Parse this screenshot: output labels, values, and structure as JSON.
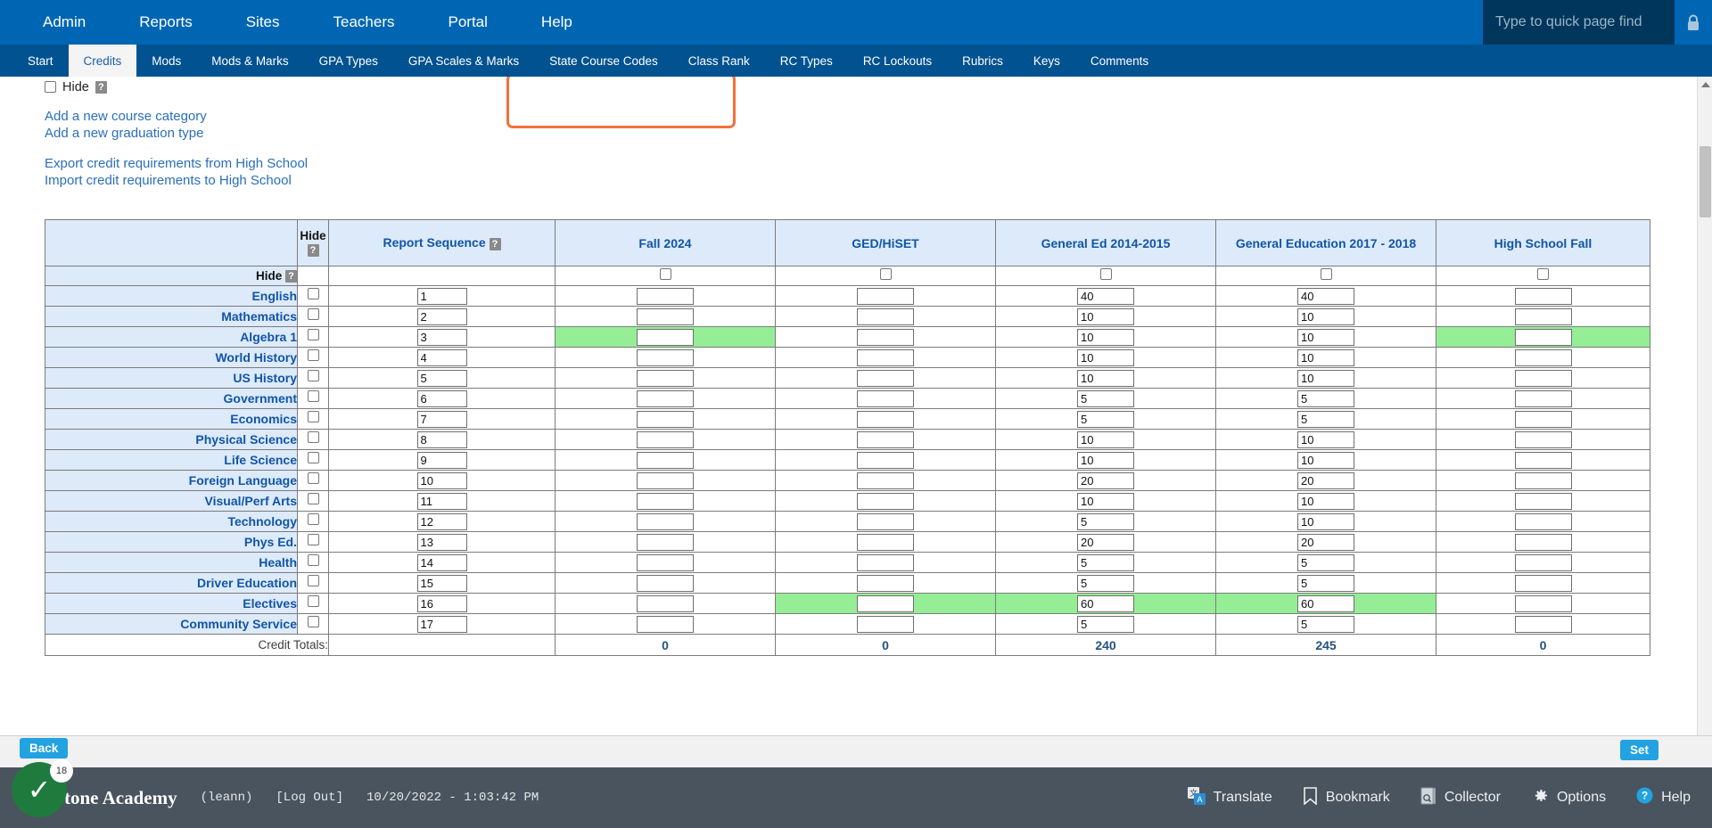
{
  "topnav": {
    "items": [
      "Admin",
      "Reports",
      "Sites",
      "Teachers",
      "Portal",
      "Help"
    ],
    "quick_find_placeholder": "Type to quick page find",
    "lock_icon": "lock-icon"
  },
  "subnav": {
    "items": [
      "Start",
      "Credits",
      "Mods",
      "Mods & Marks",
      "GPA Types",
      "GPA Scales & Marks",
      "State Course Codes",
      "Class Rank",
      "RC Types",
      "RC Lockouts",
      "Rubrics",
      "Keys",
      "Comments"
    ],
    "active": "Credits"
  },
  "content": {
    "hide_label": "Hide",
    "help_glyph": "?",
    "links": [
      "Add a new course category",
      "Add a new graduation type"
    ],
    "links2": [
      "Export credit requirements from High School",
      "Import credit requirements to High School"
    ]
  },
  "table": {
    "hide_col_header": "Hide",
    "hide_row_label": "Hide",
    "totals_label": "Credit Totals:",
    "columns": [
      {
        "label": "Report Sequence",
        "has_help": true,
        "type": "sequence"
      },
      {
        "label": "Fall 2024",
        "has_help": false,
        "type": "credit"
      },
      {
        "label": "GED/HiSET",
        "has_help": false,
        "type": "credit",
        "highlighted": true
      },
      {
        "label": "General Ed 2014-2015",
        "has_help": false,
        "type": "credit"
      },
      {
        "label": "General Education 2017 - 2018",
        "has_help": false,
        "type": "credit"
      },
      {
        "label": "High School Fall",
        "has_help": false,
        "type": "credit"
      }
    ],
    "rows": [
      {
        "label": "English",
        "seq": "1",
        "values": [
          "",
          "",
          "40",
          "40",
          ""
        ],
        "green": []
      },
      {
        "label": "Mathematics",
        "seq": "2",
        "values": [
          "",
          "",
          "10",
          "10",
          ""
        ],
        "green": []
      },
      {
        "label": "Algebra 1",
        "seq": "3",
        "values": [
          "",
          "",
          "10",
          "10",
          ""
        ],
        "green": [
          0,
          4
        ]
      },
      {
        "label": "World History",
        "seq": "4",
        "values": [
          "",
          "",
          "10",
          "10",
          ""
        ],
        "green": []
      },
      {
        "label": "US History",
        "seq": "5",
        "values": [
          "",
          "",
          "10",
          "10",
          ""
        ],
        "green": []
      },
      {
        "label": "Government",
        "seq": "6",
        "values": [
          "",
          "",
          "5",
          "5",
          ""
        ],
        "green": []
      },
      {
        "label": "Economics",
        "seq": "7",
        "values": [
          "",
          "",
          "5",
          "5",
          ""
        ],
        "green": []
      },
      {
        "label": "Physical Science",
        "seq": "8",
        "values": [
          "",
          "",
          "10",
          "10",
          ""
        ],
        "green": []
      },
      {
        "label": "Life Science",
        "seq": "9",
        "values": [
          "",
          "",
          "10",
          "10",
          ""
        ],
        "green": []
      },
      {
        "label": "Foreign Language",
        "seq": "10",
        "values": [
          "",
          "",
          "20",
          "20",
          ""
        ],
        "green": []
      },
      {
        "label": "Visual/Perf Arts",
        "seq": "11",
        "values": [
          "",
          "",
          "10",
          "10",
          ""
        ],
        "green": []
      },
      {
        "label": "Technology",
        "seq": "12",
        "values": [
          "",
          "",
          "5",
          "10",
          ""
        ],
        "green": []
      },
      {
        "label": "Phys Ed.",
        "seq": "13",
        "values": [
          "",
          "",
          "20",
          "20",
          ""
        ],
        "green": []
      },
      {
        "label": "Health",
        "seq": "14",
        "values": [
          "",
          "",
          "5",
          "5",
          ""
        ],
        "green": []
      },
      {
        "label": "Driver Education",
        "seq": "15",
        "values": [
          "",
          "",
          "5",
          "5",
          ""
        ],
        "green": []
      },
      {
        "label": "Electives",
        "seq": "16",
        "values": [
          "",
          "",
          "60",
          "60",
          ""
        ],
        "green": [
          1,
          2,
          3
        ]
      },
      {
        "label": "Community Service",
        "seq": "17",
        "values": [
          "",
          "",
          "5",
          "5",
          ""
        ],
        "green": []
      }
    ],
    "totals": [
      "0",
      "0",
      "240",
      "245",
      "0"
    ]
  },
  "actions": {
    "back_label": "Back",
    "set_label": "Set"
  },
  "toast": {
    "badge_count": "18",
    "check_glyph": "✓"
  },
  "footer": {
    "school": "tone Academy",
    "user": "(leann)",
    "logout": "[Log Out]",
    "datetime": "10/20/2022 - 1:03:42 PM",
    "items": [
      {
        "label": "Translate",
        "icon": "translate-icon"
      },
      {
        "label": "Bookmark",
        "icon": "bookmark-icon"
      },
      {
        "label": "Collector",
        "icon": "collector-icon"
      },
      {
        "label": "Options",
        "icon": "gear-icon"
      },
      {
        "label": "Help",
        "icon": "help-icon"
      }
    ]
  },
  "colors": {
    "nav_blue": "#0066b3",
    "subnav_blue": "#005290",
    "header_cell": "#ddeafa",
    "link_blue": "#2a6ebb",
    "highlight_orange": "#f4703a",
    "green_row": "#95ee95",
    "footer_gray": "#4a545e",
    "button_blue": "#22a2e0"
  }
}
